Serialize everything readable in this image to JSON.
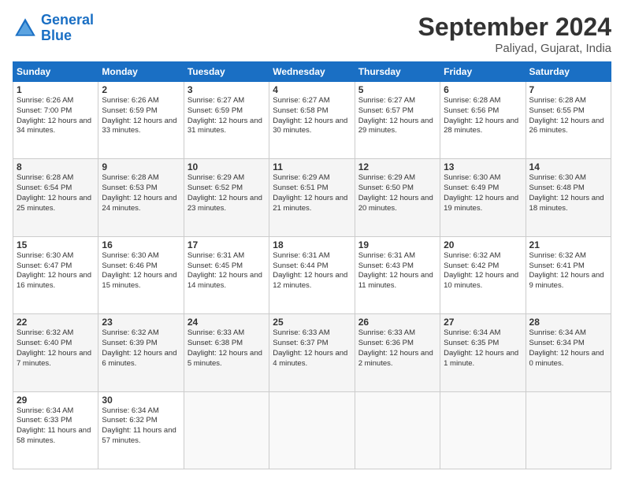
{
  "logo": {
    "line1": "General",
    "line2": "Blue"
  },
  "title": "September 2024",
  "location": "Paliyad, Gujarat, India",
  "days_header": [
    "Sunday",
    "Monday",
    "Tuesday",
    "Wednesday",
    "Thursday",
    "Friday",
    "Saturday"
  ],
  "weeks": [
    [
      {
        "num": "1",
        "sunrise": "6:26 AM",
        "sunset": "7:00 PM",
        "daylight": "12 hours and 34 minutes."
      },
      {
        "num": "2",
        "sunrise": "6:26 AM",
        "sunset": "6:59 PM",
        "daylight": "12 hours and 33 minutes."
      },
      {
        "num": "3",
        "sunrise": "6:27 AM",
        "sunset": "6:59 PM",
        "daylight": "12 hours and 31 minutes."
      },
      {
        "num": "4",
        "sunrise": "6:27 AM",
        "sunset": "6:58 PM",
        "daylight": "12 hours and 30 minutes."
      },
      {
        "num": "5",
        "sunrise": "6:27 AM",
        "sunset": "6:57 PM",
        "daylight": "12 hours and 29 minutes."
      },
      {
        "num": "6",
        "sunrise": "6:28 AM",
        "sunset": "6:56 PM",
        "daylight": "12 hours and 28 minutes."
      },
      {
        "num": "7",
        "sunrise": "6:28 AM",
        "sunset": "6:55 PM",
        "daylight": "12 hours and 26 minutes."
      }
    ],
    [
      {
        "num": "8",
        "sunrise": "6:28 AM",
        "sunset": "6:54 PM",
        "daylight": "12 hours and 25 minutes."
      },
      {
        "num": "9",
        "sunrise": "6:28 AM",
        "sunset": "6:53 PM",
        "daylight": "12 hours and 24 minutes."
      },
      {
        "num": "10",
        "sunrise": "6:29 AM",
        "sunset": "6:52 PM",
        "daylight": "12 hours and 23 minutes."
      },
      {
        "num": "11",
        "sunrise": "6:29 AM",
        "sunset": "6:51 PM",
        "daylight": "12 hours and 21 minutes."
      },
      {
        "num": "12",
        "sunrise": "6:29 AM",
        "sunset": "6:50 PM",
        "daylight": "12 hours and 20 minutes."
      },
      {
        "num": "13",
        "sunrise": "6:30 AM",
        "sunset": "6:49 PM",
        "daylight": "12 hours and 19 minutes."
      },
      {
        "num": "14",
        "sunrise": "6:30 AM",
        "sunset": "6:48 PM",
        "daylight": "12 hours and 18 minutes."
      }
    ],
    [
      {
        "num": "15",
        "sunrise": "6:30 AM",
        "sunset": "6:47 PM",
        "daylight": "12 hours and 16 minutes."
      },
      {
        "num": "16",
        "sunrise": "6:30 AM",
        "sunset": "6:46 PM",
        "daylight": "12 hours and 15 minutes."
      },
      {
        "num": "17",
        "sunrise": "6:31 AM",
        "sunset": "6:45 PM",
        "daylight": "12 hours and 14 minutes."
      },
      {
        "num": "18",
        "sunrise": "6:31 AM",
        "sunset": "6:44 PM",
        "daylight": "12 hours and 12 minutes."
      },
      {
        "num": "19",
        "sunrise": "6:31 AM",
        "sunset": "6:43 PM",
        "daylight": "12 hours and 11 minutes."
      },
      {
        "num": "20",
        "sunrise": "6:32 AM",
        "sunset": "6:42 PM",
        "daylight": "12 hours and 10 minutes."
      },
      {
        "num": "21",
        "sunrise": "6:32 AM",
        "sunset": "6:41 PM",
        "daylight": "12 hours and 9 minutes."
      }
    ],
    [
      {
        "num": "22",
        "sunrise": "6:32 AM",
        "sunset": "6:40 PM",
        "daylight": "12 hours and 7 minutes."
      },
      {
        "num": "23",
        "sunrise": "6:32 AM",
        "sunset": "6:39 PM",
        "daylight": "12 hours and 6 minutes."
      },
      {
        "num": "24",
        "sunrise": "6:33 AM",
        "sunset": "6:38 PM",
        "daylight": "12 hours and 5 minutes."
      },
      {
        "num": "25",
        "sunrise": "6:33 AM",
        "sunset": "6:37 PM",
        "daylight": "12 hours and 4 minutes."
      },
      {
        "num": "26",
        "sunrise": "6:33 AM",
        "sunset": "6:36 PM",
        "daylight": "12 hours and 2 minutes."
      },
      {
        "num": "27",
        "sunrise": "6:34 AM",
        "sunset": "6:35 PM",
        "daylight": "12 hours and 1 minute."
      },
      {
        "num": "28",
        "sunrise": "6:34 AM",
        "sunset": "6:34 PM",
        "daylight": "12 hours and 0 minutes."
      }
    ],
    [
      {
        "num": "29",
        "sunrise": "6:34 AM",
        "sunset": "6:33 PM",
        "daylight": "11 hours and 58 minutes."
      },
      {
        "num": "30",
        "sunrise": "6:34 AM",
        "sunset": "6:32 PM",
        "daylight": "11 hours and 57 minutes."
      },
      null,
      null,
      null,
      null,
      null
    ]
  ]
}
